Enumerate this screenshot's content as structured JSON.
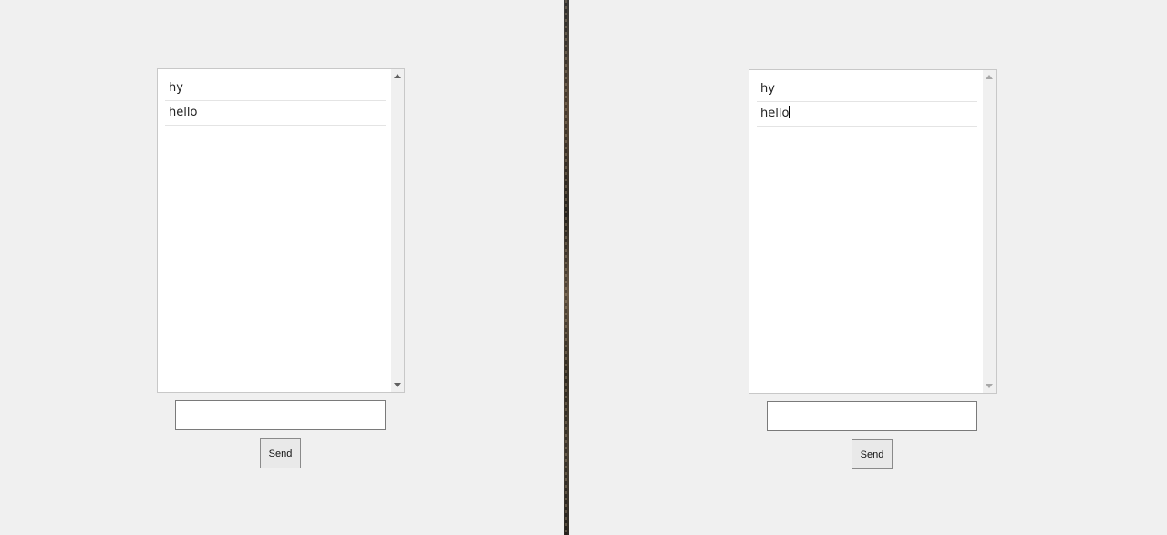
{
  "left_window": {
    "messages": [
      "hy",
      "hello"
    ],
    "input_value": "",
    "send_label": "Send"
  },
  "right_window": {
    "messages": [
      "hy",
      "hello"
    ],
    "input_value": "",
    "send_label": "Send"
  },
  "icons": {
    "scroll_up": "triangle-up-icon",
    "scroll_down": "triangle-down-icon"
  },
  "colors": {
    "background": "#f0f0f0",
    "list_background": "#ffffff",
    "divider": "#3a3a38"
  }
}
